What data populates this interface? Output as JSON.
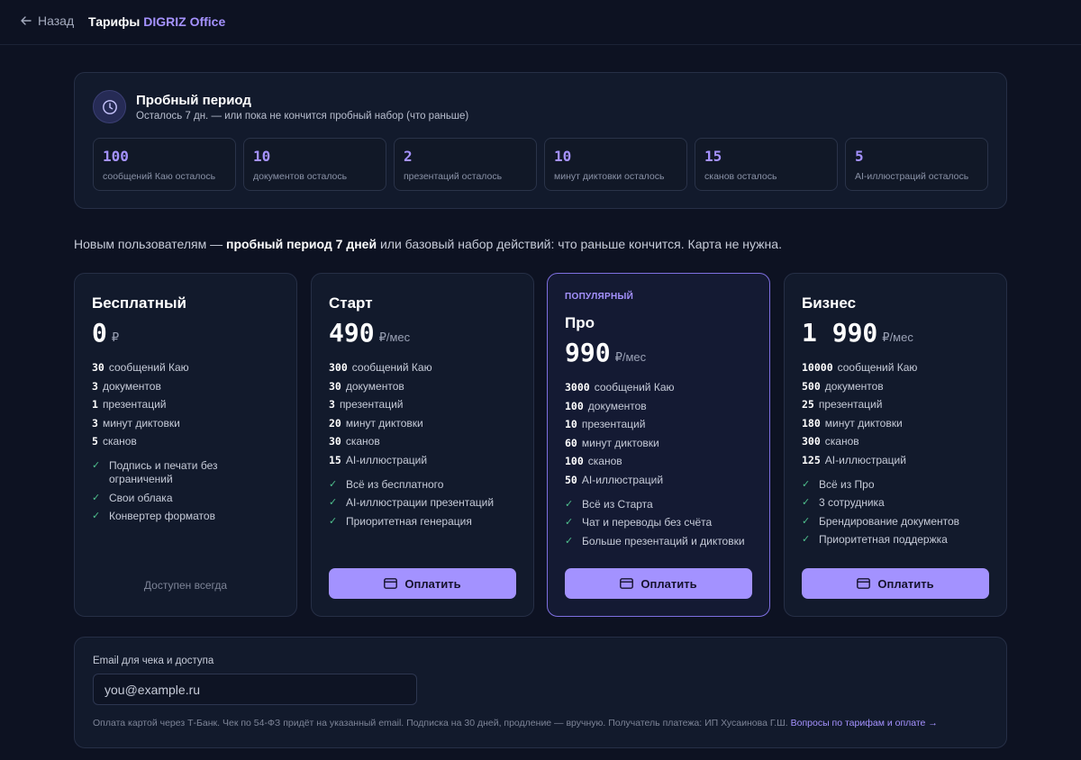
{
  "header": {
    "back_label": "Назад",
    "title_prefix": "Тарифы ",
    "title_brand": "DIGRIZ Office"
  },
  "trial": {
    "title": "Пробный период",
    "subtitle": "Осталось 7 дн. — или пока не кончится пробный набор (что раньше)",
    "stats": [
      {
        "value": "100",
        "label": "сообщений Каю осталось"
      },
      {
        "value": "10",
        "label": "документов осталось"
      },
      {
        "value": "2",
        "label": "презентаций осталось"
      },
      {
        "value": "10",
        "label": "минут диктовки осталось"
      },
      {
        "value": "15",
        "label": "сканов осталось"
      },
      {
        "value": "5",
        "label": "AI-иллюстраций осталось"
      }
    ]
  },
  "promo": {
    "before": "Новым пользователям — ",
    "bold": "пробный период 7 дней",
    "after": " или базовый набор действий: что раньше кончится. Карта не нужна."
  },
  "plans": [
    {
      "name": "Бесплатный",
      "price": "0",
      "unit": "₽",
      "features": [
        {
          "n": "30",
          "t": "сообщений Каю"
        },
        {
          "n": "3",
          "t": "документов"
        },
        {
          "n": "1",
          "t": "презентаций"
        },
        {
          "n": "3",
          "t": "минут диктовки"
        },
        {
          "n": "5",
          "t": "сканов"
        }
      ],
      "perks": [
        "Подпись и печати без ограничений",
        "Свои облака",
        "Конвертер форматов"
      ],
      "footer": "Доступен всегда"
    },
    {
      "name": "Старт",
      "price": "490",
      "unit": "₽/мес",
      "features": [
        {
          "n": "300",
          "t": "сообщений Каю"
        },
        {
          "n": "30",
          "t": "документов"
        },
        {
          "n": "3",
          "t": "презентаций"
        },
        {
          "n": "20",
          "t": "минут диктовки"
        },
        {
          "n": "30",
          "t": "сканов"
        },
        {
          "n": "15",
          "t": "AI-иллюстраций"
        }
      ],
      "perks": [
        "Всё из бесплатного",
        "AI-иллюстрации презентаций",
        "Приоритетная генерация"
      ],
      "button": "Оплатить"
    },
    {
      "badge": "ПОПУЛЯРНЫЙ",
      "name": "Про",
      "price": "990",
      "unit": "₽/мес",
      "features": [
        {
          "n": "3000",
          "t": "сообщений Каю"
        },
        {
          "n": "100",
          "t": "документов"
        },
        {
          "n": "10",
          "t": "презентаций"
        },
        {
          "n": "60",
          "t": "минут диктовки"
        },
        {
          "n": "100",
          "t": "сканов"
        },
        {
          "n": "50",
          "t": "AI-иллюстраций"
        }
      ],
      "perks": [
        "Всё из Старта",
        "Чат и переводы без счёта",
        "Больше презентаций и диктовки"
      ],
      "button": "Оплатить"
    },
    {
      "name": "Бизнес",
      "price": "1 990",
      "unit": "₽/мес",
      "features": [
        {
          "n": "10000",
          "t": "сообщений Каю"
        },
        {
          "n": "500",
          "t": "документов"
        },
        {
          "n": "25",
          "t": "презентаций"
        },
        {
          "n": "180",
          "t": "минут диктовки"
        },
        {
          "n": "300",
          "t": "сканов"
        },
        {
          "n": "125",
          "t": "AI-иллюстраций"
        }
      ],
      "perks": [
        "Всё из Про",
        "3 сотрудника",
        "Брендирование документов",
        "Приоритетная поддержка"
      ],
      "button": "Оплатить"
    }
  ],
  "email": {
    "label": "Email для чека и доступа",
    "placeholder": "you@example.ru",
    "value": "",
    "note": "Оплата картой через Т-Банк. Чек по 54-ФЗ придёт на указанный email. Подписка на 30 дней, продление — вручную. Получатель платежа: ИП Хусаинова Г.Ш. ",
    "link": "Вопросы по тарифам и оплате →"
  },
  "colors": {
    "accent": "#a592ff",
    "button": "#a392ff",
    "check": "#4fc08d",
    "background": "#0d1222"
  }
}
